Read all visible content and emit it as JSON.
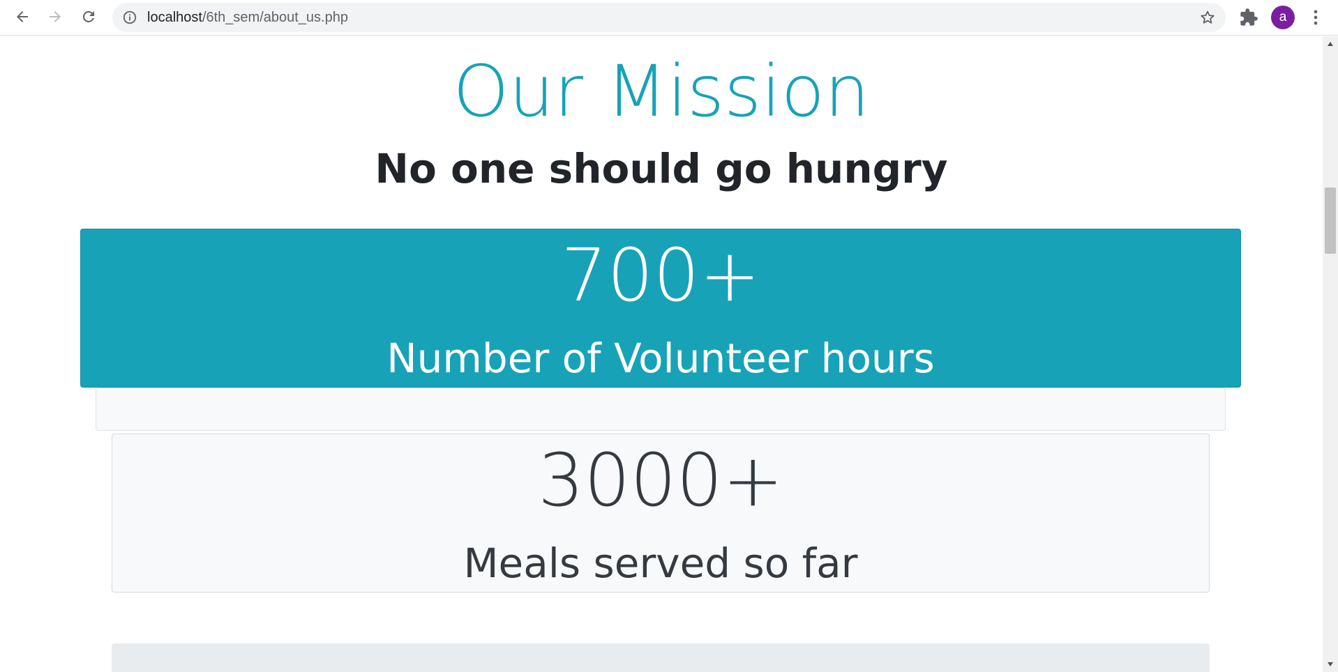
{
  "browser": {
    "url_host": "localhost",
    "url_path": "/6th_sem/about_us.php",
    "avatar_letter": "a",
    "icons": [
      "back-arrow-icon",
      "forward-arrow-icon",
      "reload-icon",
      "info-icon",
      "star-icon",
      "puzzle-icon",
      "kebab-menu-icon"
    ]
  },
  "mission": {
    "title": "Our Mission",
    "subtitle": "No one should go hungry"
  },
  "stats": [
    {
      "number": "700+",
      "label": "Number of Volunteer hours"
    },
    {
      "number": "3000+",
      "label": "Meals served so far"
    }
  ],
  "colors": {
    "accent": "#17a2b8",
    "light_card": "#f8f9fa",
    "dark_text": "#343a40",
    "avatar": "#7b1fa2"
  }
}
